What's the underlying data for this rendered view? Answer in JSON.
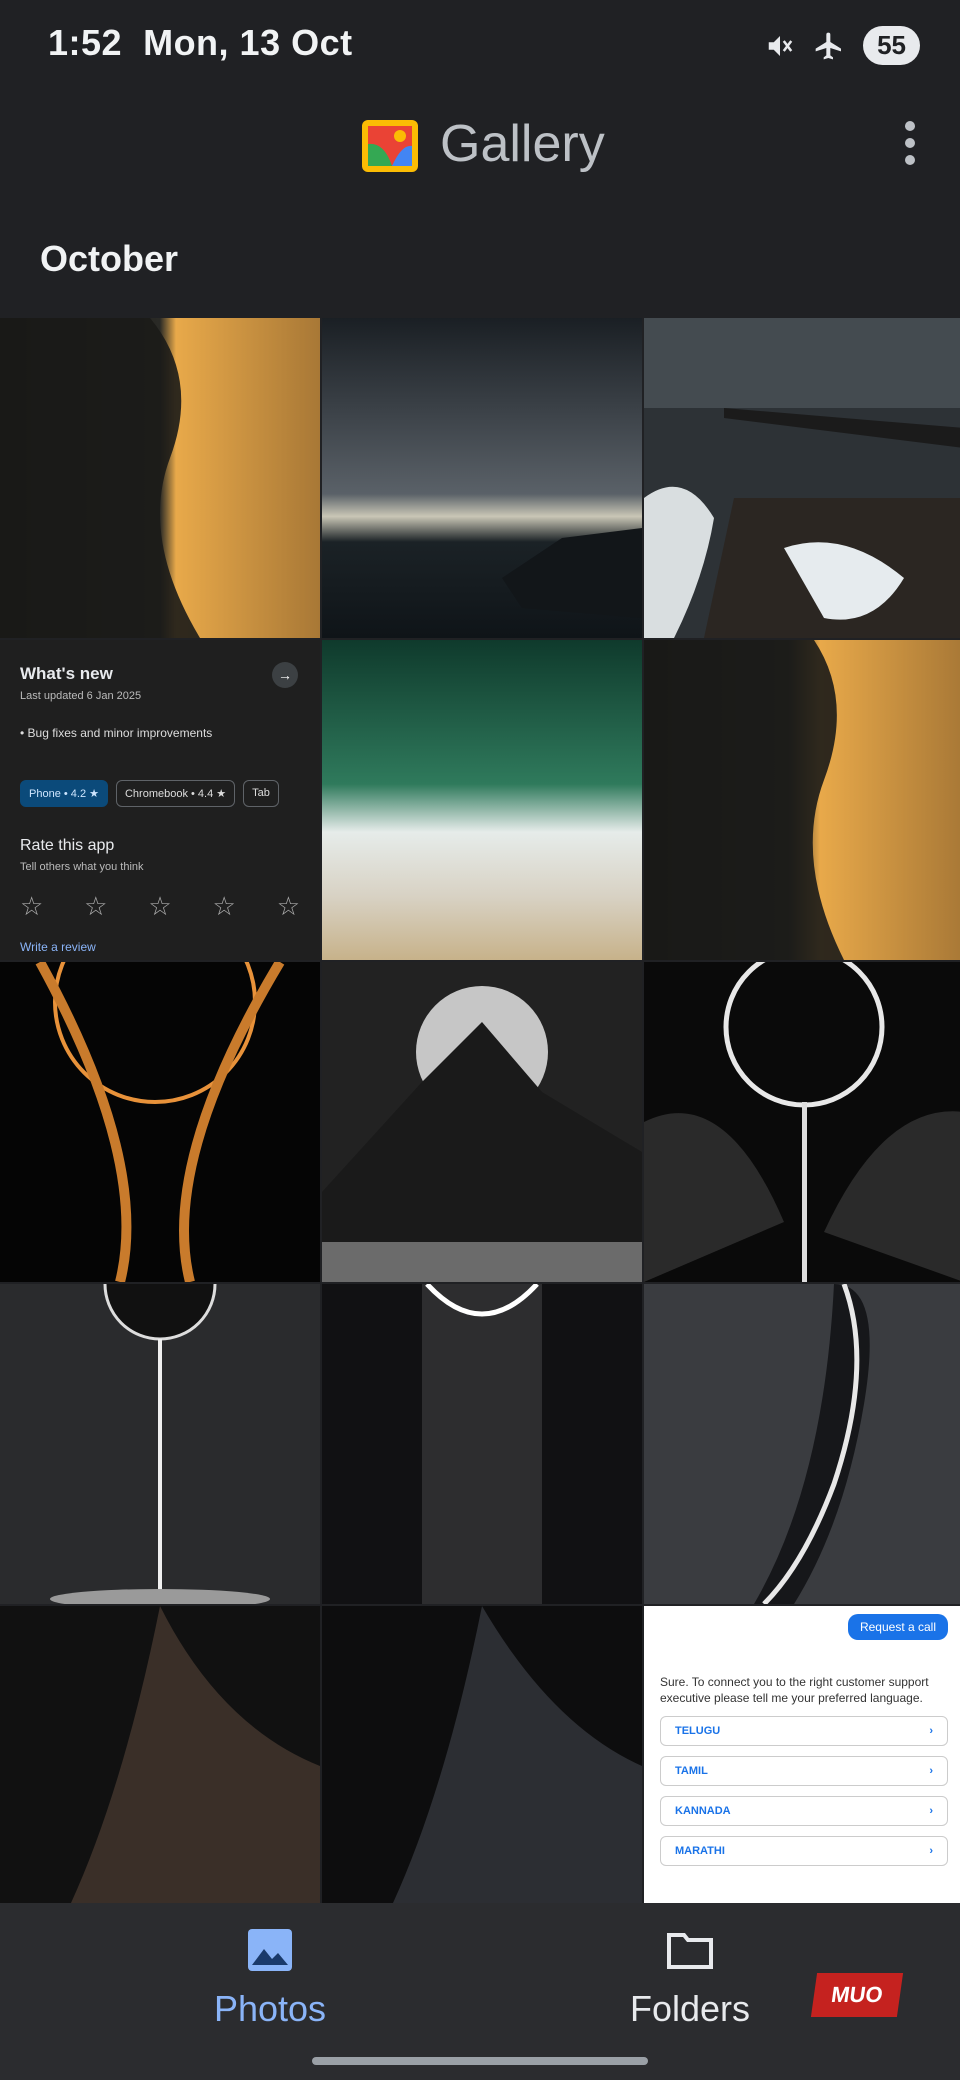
{
  "status_bar": {
    "time": "1:52",
    "date": "Mon, 13 Oct",
    "battery": "55",
    "icons": [
      "mute-icon",
      "airplane-icon"
    ]
  },
  "app": {
    "title": "Gallery"
  },
  "section": {
    "month": "October"
  },
  "play_tile": {
    "heading": "What's new",
    "updated": "Last updated 6 Jan 2025",
    "bullet": "• Bug fixes and minor improvements",
    "chips": [
      "Phone • 4.2 ★",
      "Chromebook • 4.4 ★",
      "Tab"
    ],
    "rate_heading": "Rate this app",
    "rate_sub": "Tell others what you think",
    "review_link": "Write a review"
  },
  "chat_tile": {
    "bubble": "Request a call",
    "message": "Sure. To connect you to the right customer support executive please tell me your preferred language.",
    "options": [
      "TELUGU",
      "TAMIL",
      "KANNADA",
      "MARATHI"
    ]
  },
  "nav": {
    "photos_label": "Photos",
    "folders_label": "Folders"
  },
  "watermark": "MUO",
  "colors": {
    "background": "#202124",
    "accent": "#8ab4f8",
    "nav_bg": "#2b2c2f"
  }
}
